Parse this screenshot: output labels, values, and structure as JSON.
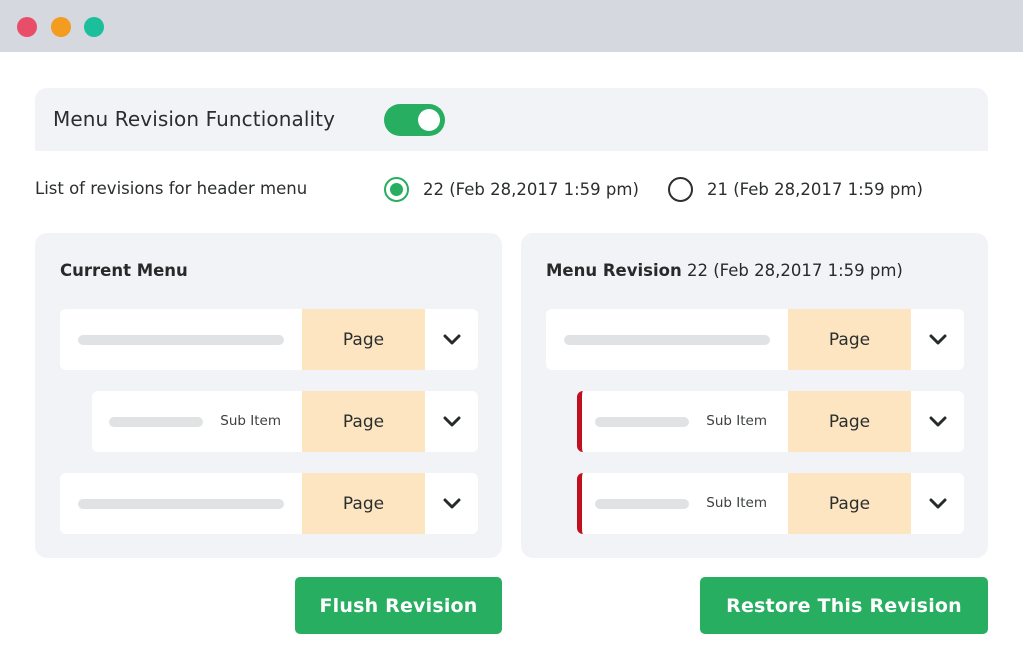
{
  "window": {
    "controls": [
      {
        "name": "close",
        "color": "#e94e69"
      },
      {
        "name": "minimize",
        "color": "#f39c1f"
      },
      {
        "name": "maximize",
        "color": "#1bbf9b"
      }
    ]
  },
  "header": {
    "title": "Menu Revision Functionality",
    "toggle_on": true,
    "accent_color": "#27ae60"
  },
  "revisions": {
    "label": "List of revisions for header menu",
    "options": [
      {
        "label": "22 (Feb 28,2017 1:59 pm)",
        "checked": true
      },
      {
        "label": "21 (Feb 28,2017 1:59 pm)",
        "checked": false
      }
    ]
  },
  "current_menu": {
    "title": "Current Menu",
    "rows": [
      {
        "type": "item",
        "sub_label": "",
        "page_label": "Page"
      },
      {
        "type": "sub",
        "sub_label": "Sub Item",
        "page_label": "Page"
      },
      {
        "type": "item",
        "sub_label": "",
        "page_label": "Page"
      }
    ]
  },
  "menu_revision": {
    "title_bold": "Menu Revision",
    "title_rest": "22 (Feb 28,2017 1:59 pm)",
    "changed_color": "#c0101f",
    "rows": [
      {
        "type": "item",
        "sub_label": "",
        "page_label": "Page",
        "changed": false
      },
      {
        "type": "sub",
        "sub_label": "Sub Item",
        "page_label": "Page",
        "changed": true
      },
      {
        "type": "sub",
        "sub_label": "Sub Item",
        "page_label": "Page",
        "changed": true
      }
    ]
  },
  "actions": {
    "flush_label": "Flush Revision",
    "restore_label": "Restore This Revision"
  }
}
